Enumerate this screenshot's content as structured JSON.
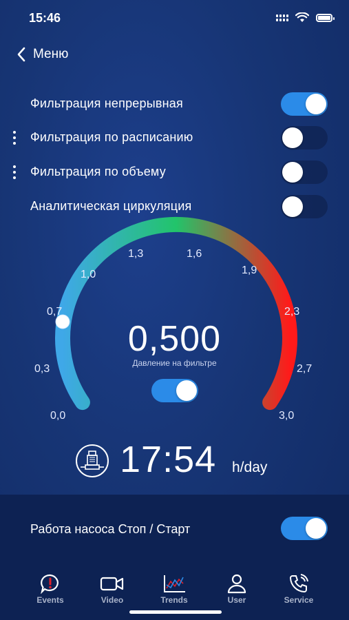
{
  "status_bar": {
    "time": "15:46"
  },
  "nav": {
    "back_label": "Меню"
  },
  "settings": [
    {
      "label": "Фильтрация непрерывная",
      "enabled": true,
      "has_menu": false
    },
    {
      "label": "Фильтрация по расписанию",
      "enabled": false,
      "has_menu": true
    },
    {
      "label": "Фильтрация по объему",
      "enabled": false,
      "has_menu": true
    },
    {
      "label": "Аналитическая циркуляция",
      "enabled": false,
      "has_menu": false
    }
  ],
  "gauge": {
    "value": "0,500",
    "caption": "Давление на фильтре",
    "value_numeric": 0.5,
    "min": 0,
    "max": 3.0,
    "ticks": [
      "0,0",
      "0,3",
      "0,7",
      "1,0",
      "1,3",
      "1,6",
      "1,9",
      "2,3",
      "2,7",
      "3,0"
    ],
    "toggle_enabled": true,
    "colors": {
      "start": "#3fa8e8",
      "mid": "#22c46a",
      "end": "#ff1a1a"
    }
  },
  "pump": {
    "hours": "17:54",
    "unit": "h/day"
  },
  "pump_control": {
    "label": "Работа насоса Стоп / Старт",
    "enabled": true
  },
  "tabs": [
    {
      "label": "Events",
      "icon": "alert-bubble-icon"
    },
    {
      "label": "Video",
      "icon": "video-camera-icon"
    },
    {
      "label": "Trends",
      "icon": "trend-chart-icon"
    },
    {
      "label": "User",
      "icon": "user-icon"
    },
    {
      "label": "Service",
      "icon": "service-phone-icon"
    }
  ],
  "accent_color": "#2b8be8",
  "alert_color": "#e0202a"
}
